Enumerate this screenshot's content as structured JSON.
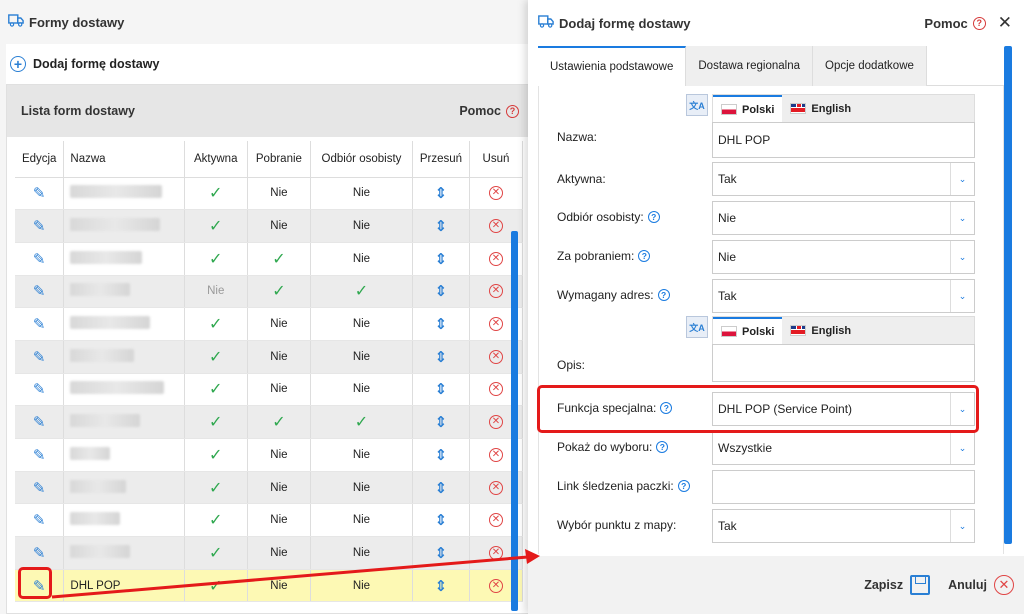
{
  "left": {
    "page_title": "Formy dostawy",
    "add_button": "Dodaj formę dostawy",
    "list_title": "Lista form dostawy",
    "help_label": "Pomoc",
    "columns": [
      "Edycja",
      "Nazwa",
      "Aktywna",
      "Pobranie",
      "Odbiór osobisty",
      "Przesuń",
      "Usuń"
    ],
    "rows": [
      {
        "name": "",
        "active": "check",
        "cod": "Nie",
        "pickup": "Nie"
      },
      {
        "name": "",
        "active": "check",
        "cod": "Nie",
        "pickup": "Nie"
      },
      {
        "name": "",
        "active": "check",
        "cod": "check",
        "pickup": "Nie"
      },
      {
        "name": "",
        "active": "Nie",
        "cod": "check",
        "pickup": "check"
      },
      {
        "name": "",
        "active": "check",
        "cod": "Nie",
        "pickup": "Nie"
      },
      {
        "name": "",
        "active": "check",
        "cod": "Nie",
        "pickup": "Nie"
      },
      {
        "name": "",
        "active": "check",
        "cod": "Nie",
        "pickup": "Nie"
      },
      {
        "name": "",
        "active": "check",
        "cod": "check",
        "pickup": "check"
      },
      {
        "name": "",
        "active": "check",
        "cod": "Nie",
        "pickup": "Nie"
      },
      {
        "name": "",
        "active": "check",
        "cod": "Nie",
        "pickup": "Nie"
      },
      {
        "name": "",
        "active": "check",
        "cod": "Nie",
        "pickup": "Nie"
      },
      {
        "name": "",
        "active": "check",
        "cod": "Nie",
        "pickup": "Nie"
      },
      {
        "name": "DHL POP",
        "active": "check",
        "cod": "Nie",
        "pickup": "Nie"
      }
    ]
  },
  "modal": {
    "title": "Dodaj formę dostawy",
    "help_label": "Pomoc",
    "tabs": [
      "Ustawienia podstawowe",
      "Dostawa regionalna",
      "Opcje dodatkowe"
    ],
    "lang_pl": "Polski",
    "lang_en": "English",
    "fields": {
      "name_label": "Nazwa:",
      "name_value": "DHL POP",
      "active_label": "Aktywna:",
      "active_value": "Tak",
      "pickup_label": "Odbiór osobisty:",
      "pickup_value": "Nie",
      "cod_label": "Za pobraniem:",
      "cod_value": "Nie",
      "address_label": "Wymagany adres:",
      "address_value": "Tak",
      "desc_label": "Opis:",
      "special_label": "Funkcja specjalna:",
      "special_value": "DHL POP (Service Point)",
      "show_label": "Pokaż do wyboru:",
      "show_value": "Wszystkie",
      "track_label": "Link śledzenia paczki:",
      "map_label": "Wybór punktu z mapy:",
      "map_value": "Tak"
    },
    "save_label": "Zapisz",
    "cancel_label": "Anuluj"
  },
  "colors": {
    "accent": "#1a7be0",
    "highlight": "#e41a1a",
    "row_highlight": "#fdf9b4"
  }
}
